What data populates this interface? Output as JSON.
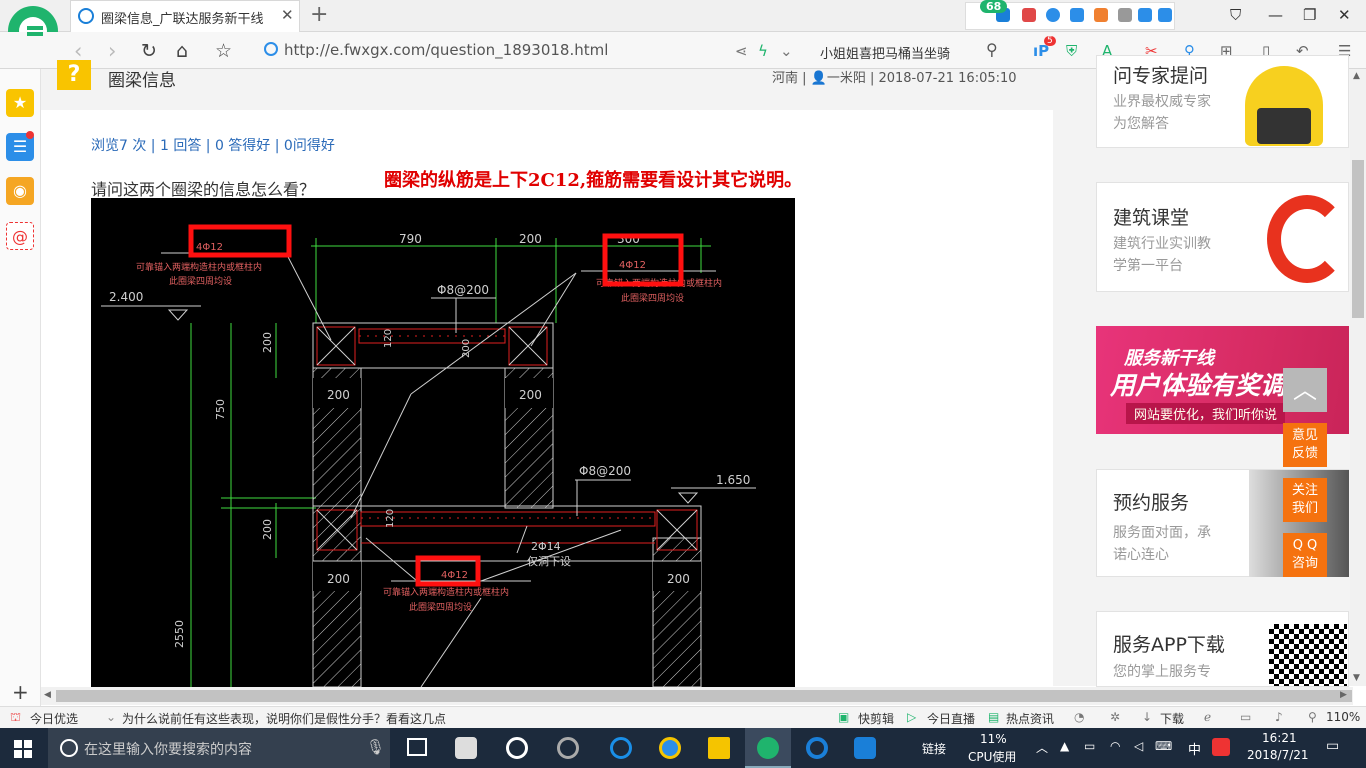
{
  "browser": {
    "tab_title": "圈梁信息_广联达服务新干线",
    "new_tab": "+",
    "ext_badge": "68",
    "url": "http://e.fwxgx.com/question_1893018.html",
    "search_text": "小姐姐喜把马桶当坐骑",
    "ip_badge": "5"
  },
  "question": {
    "title": "圈梁信息",
    "meta": "河南 | 👤一米阳 | 2018-07-21 16:05:10",
    "stats": "浏览7 次 | 1 回答 | 0 答得好 | 0问得好",
    "text": "请问这两个圈梁的信息怎么看？",
    "answer_note": "圈梁的纵筋是上下2C12,箍筋需要看设计其它说明。"
  },
  "cad": {
    "dim_790": "790",
    "dim_200_top": "200",
    "dim_300": "300",
    "elev_2400": "2.400",
    "elev_1650": "1.650",
    "rebar_top_left": "4Φ12",
    "rebar_top_right": "4Φ12",
    "rebar_bottom": "4Φ12",
    "note_top_left_1": "可靠锚入两端构造柱内或框柱内",
    "note_top_left_2": "此圈梁四周均设",
    "note_top_right_1": "可靠锚入两端构造柱内或框柱内",
    "note_top_right_2": "此圈梁四周均设",
    "note_bottom_1": "可靠锚入两端构造柱内或框柱内",
    "note_bottom_2": "此圈梁四周均设",
    "stirrup_top": "Φ8@200",
    "stirrup_bottom": "Φ8@200",
    "bar_2phi14": "2Φ14",
    "bar_2phi14_note": "仅洞下设",
    "dim_200_v1": "200",
    "dim_120_a": "120",
    "dim_200_beam": "200",
    "dim_200_col_l": "200",
    "dim_200_col_r": "200",
    "dim_750": "750",
    "dim_200_v2": "200",
    "dim_120_b": "120",
    "dim_200_col_l2": "200",
    "dim_200_col_r2": "200",
    "dim_2550": "2550"
  },
  "sidebar": {
    "card1_title": "问专家提问",
    "card1_sub1": "业界最权威专家",
    "card1_sub2": "为您解答",
    "card2_title": "建筑课堂",
    "card2_sub1": "建筑行业实训教",
    "card2_sub2": "学第一平台",
    "banner_t1": "服务新干线",
    "banner_t2": "用户体验有奖调研",
    "banner_t3": "网站要优化，我们听你说",
    "card3_title": "预约服务",
    "card3_sub1": "服务面对面，承",
    "card3_sub2": "诺心连心",
    "card4_title": "服务APP下载",
    "card4_sub1": "您的掌上服务专"
  },
  "float_buttons": {
    "feedback_1": "意见",
    "feedback_2": "反馈",
    "follow_1": "关注",
    "follow_2": "我们",
    "qq_1": "Q Q",
    "qq_2": "咨询"
  },
  "statusbar": {
    "today": "今日优选",
    "news": "为什么说前任有这些表现，说明你们是假性分手？看看这几点",
    "quick_clip": "快剪辑",
    "live": "今日直播",
    "hot_news": "热点资讯",
    "download": "下载",
    "zoom": "110%"
  },
  "taskbar": {
    "search_placeholder": "在这里输入你要搜索的内容",
    "link_label": "链接",
    "cpu_pct": "11%",
    "cpu_label": "CPU使用",
    "ime": "中",
    "time": "16:21",
    "date": "2018/7/21"
  }
}
